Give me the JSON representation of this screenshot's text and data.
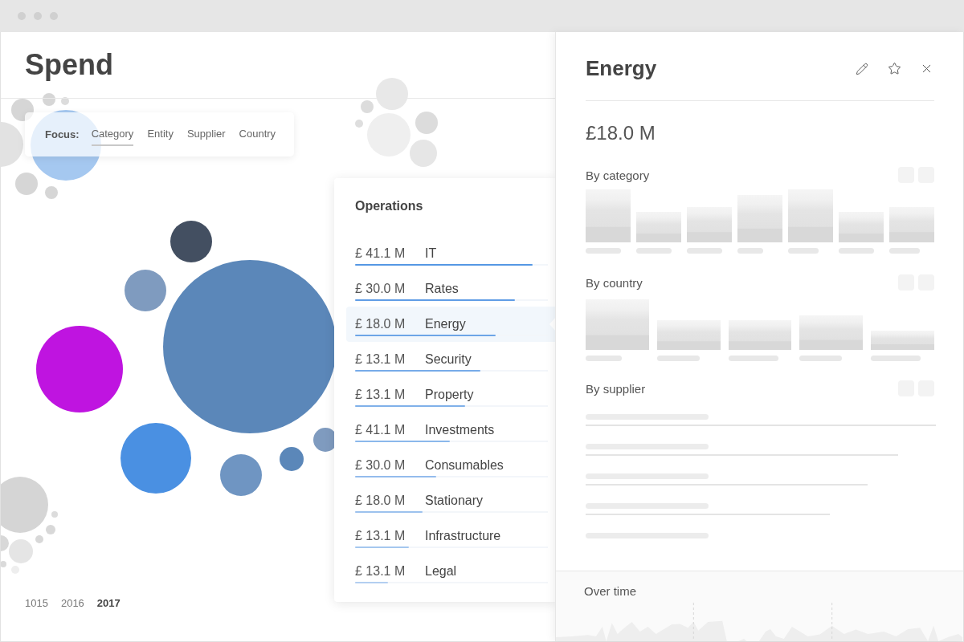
{
  "window": {
    "title": "Spend"
  },
  "focus": {
    "label": "Focus:",
    "options": [
      {
        "label": "Category",
        "selected": true
      },
      {
        "label": "Entity",
        "selected": false
      },
      {
        "label": "Supplier",
        "selected": false
      },
      {
        "label": "Country",
        "selected": false
      }
    ]
  },
  "years": [
    {
      "label": "1015",
      "selected": false
    },
    {
      "label": "2016",
      "selected": false
    },
    {
      "label": "2017",
      "selected": true
    }
  ],
  "popup": {
    "title": "Operations",
    "rows": [
      {
        "amount": "£ 41.1 M",
        "label": "IT",
        "level": 0.92,
        "selected": false
      },
      {
        "amount": "£ 30.0 M",
        "label": "Rates",
        "level": 0.83,
        "selected": false
      },
      {
        "amount": "£ 18.0 M",
        "label": "Energy",
        "level": 0.73,
        "selected": true
      },
      {
        "amount": "£ 13.1 M",
        "label": "Security",
        "level": 0.65,
        "selected": false
      },
      {
        "amount": "£ 13.1 M",
        "label": "Property",
        "level": 0.57,
        "selected": false
      },
      {
        "amount": "£ 41.1 M",
        "label": "Investments",
        "level": 0.49,
        "selected": false
      },
      {
        "amount": "£ 30.0 M",
        "label": "Consumables",
        "level": 0.42,
        "selected": false
      },
      {
        "amount": "£ 18.0 M",
        "label": "Stationary",
        "level": 0.35,
        "selected": false
      },
      {
        "amount": "£ 13.1 M",
        "label": "Infrastructure",
        "level": 0.28,
        "selected": false
      },
      {
        "amount": "£ 13.1 M",
        "label": "Legal",
        "level": 0.17,
        "selected": false
      }
    ]
  },
  "detail": {
    "title": "Energy",
    "amount": "£18.0 M",
    "sections": [
      {
        "title": "By category",
        "kind": "columns"
      },
      {
        "title": "By country",
        "kind": "wide_columns"
      },
      {
        "title": "By supplier",
        "kind": "list"
      }
    ],
    "footer": {
      "title": "Over time"
    }
  }
}
